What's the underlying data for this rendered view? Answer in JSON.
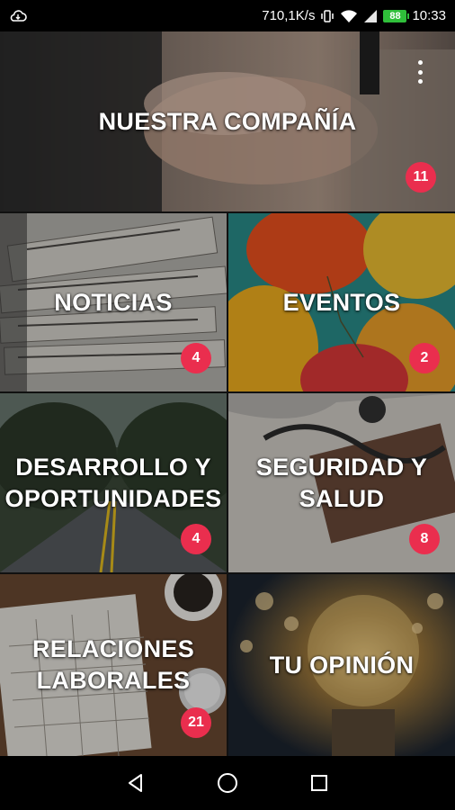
{
  "status_bar": {
    "net_speed": "710,1K/s",
    "battery": "88",
    "time": "10:33",
    "icons": [
      "cloud-sync-icon",
      "vibrate-icon",
      "wifi-icon",
      "signal-icon",
      "battery-icon"
    ]
  },
  "tiles": {
    "company": {
      "label": "NUESTRA COMPAÑÍA",
      "badge": "11"
    },
    "news": {
      "label": "NOTICIAS",
      "badge": "4"
    },
    "events": {
      "label": "EVENTOS",
      "badge": "2"
    },
    "development": {
      "label": "DESARROLLO Y\nOPORTUNIDADES",
      "badge": "4"
    },
    "safety": {
      "label": "SEGURIDAD Y\nSALUD",
      "badge": "8"
    },
    "labor": {
      "label": "RELACIONES\nLABORALES",
      "badge": "21"
    },
    "opinion": {
      "label": "TU OPINIÓN"
    }
  },
  "overflow_menu": "more-vert-icon",
  "nav_bar": [
    "back-icon",
    "home-icon",
    "recents-icon"
  ],
  "colors": {
    "badge": "#ea2e4e",
    "battery": "#2fbf3a"
  }
}
